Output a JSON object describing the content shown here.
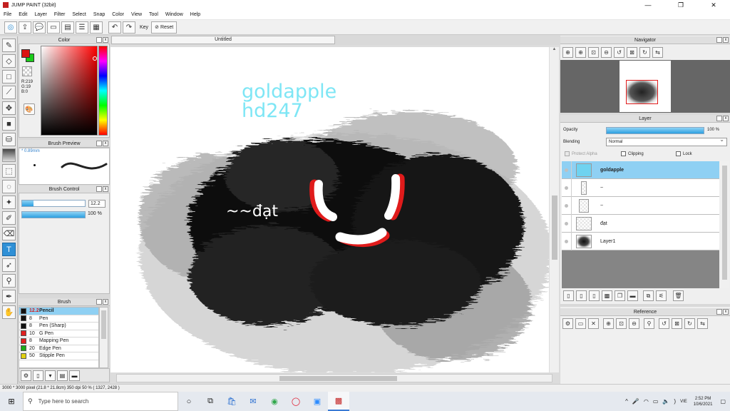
{
  "window": {
    "title": "JUMP PAINT (32bit)",
    "min": "—",
    "max": "❐",
    "close": "✕"
  },
  "menu": [
    "File",
    "Edit",
    "Layer",
    "Filter",
    "Select",
    "Snap",
    "Color",
    "View",
    "Tool",
    "Window",
    "Help"
  ],
  "toolbar": {
    "key_label": "Key",
    "reset_label": "Reset"
  },
  "panels": {
    "color": "Color",
    "brush_preview": "Brush Preview",
    "brush_control": "Brush Control",
    "brush": "Brush",
    "navigator": "Navigator",
    "layer": "Layer",
    "reference": "Reference"
  },
  "color": {
    "r": "R:219",
    "g": "G:19",
    "b": "B:0",
    "fg": "#db1313",
    "bg": "#1acb1a"
  },
  "brush_preview": {
    "size": "0.89mm"
  },
  "brush_control": {
    "size": "12.2",
    "size_fraction": 0.18,
    "opacity": "100 %",
    "opacity_fraction": 1.0
  },
  "brushes": [
    {
      "size": "12.2",
      "name": "Pencil",
      "color": "#111111",
      "selected": true
    },
    {
      "size": "8",
      "name": "Pen",
      "color": "#111111"
    },
    {
      "size": "8",
      "name": "Pen (Sharp)",
      "color": "#111111"
    },
    {
      "size": "10",
      "name": "G Pen",
      "color": "#e02020"
    },
    {
      "size": "8",
      "name": "Mapping Pen",
      "color": "#e02020"
    },
    {
      "size": "20",
      "name": "Edge Pen",
      "color": "#1aaa1a"
    },
    {
      "size": "50",
      "name": "Stipple Pen",
      "color": "#e0d010"
    }
  ],
  "document": {
    "tab": "Untitled"
  },
  "artwork": {
    "line1": "goldapple",
    "line2": "hd247",
    "label": "~~đạt",
    "text_color": "#7ee6f5"
  },
  "layer_panel": {
    "opacity_label": "Opacity",
    "opacity_value": "100 %",
    "opacity_fraction": 1.0,
    "blending_label": "Blending",
    "blending_value": "Normal",
    "protect_alpha": "Protect Alpha",
    "clipping": "Clipping",
    "lock": "Lock",
    "layers": [
      {
        "name": "goldapple",
        "selected": true
      },
      {
        "name": "~"
      },
      {
        "name": "~"
      },
      {
        "name": "đạt"
      },
      {
        "name": "Layer1"
      }
    ]
  },
  "status": {
    "text": "3000 * 3000 pixel  (21.8 * 21.8cm)  350 dpi  50 %  ( 1327, 2428 )"
  },
  "taskbar": {
    "search_placeholder": "Type here to search",
    "language": "VIE",
    "time": "2:52 PM",
    "date": "10/6/2021"
  }
}
